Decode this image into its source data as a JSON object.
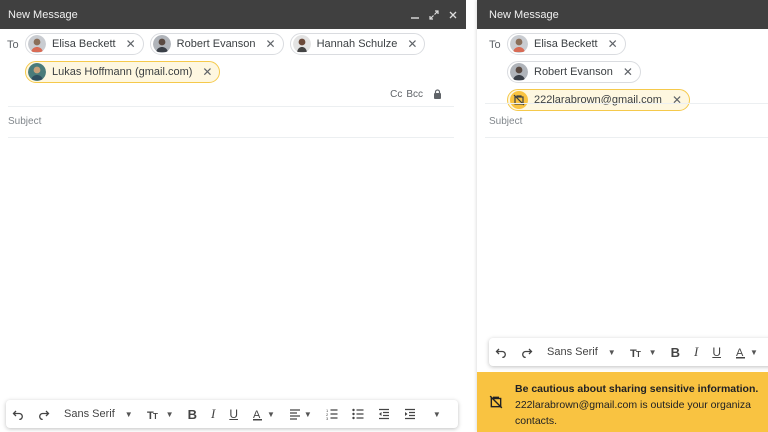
{
  "left": {
    "title": "New Message",
    "to_label": "To",
    "recipients": [
      {
        "name": "Elisa Beckett",
        "external": false
      },
      {
        "name": "Robert Evanson",
        "external": false
      },
      {
        "name": "Hannah Schulze",
        "external": false
      },
      {
        "name": "Lukas Hoffmann (gmail.com)",
        "external": true
      }
    ],
    "cc_label": "Cc",
    "bcc_label": "Bcc",
    "subject_placeholder": "Subject",
    "toolbar": {
      "font": "Sans Serif"
    }
  },
  "right": {
    "title": "New Message",
    "to_label": "To",
    "recipients": [
      {
        "name": "Elisa Beckett",
        "external": false
      },
      {
        "name": "Robert Evanson",
        "external": false
      },
      {
        "name": "222larabrown@gmail.com",
        "external": true
      }
    ],
    "subject_placeholder": "Subject",
    "toolbar": {
      "font": "Sans Serif"
    },
    "warning": {
      "title": "Be cautious about sharing sensitive information.",
      "body_line1": "222larabrown@gmail.com is outside your organiza",
      "body_line2": "contacts."
    }
  },
  "colors": {
    "titlebar": "#404040",
    "external_chip": "#fef7e0",
    "warning_bg": "#f9c341"
  }
}
